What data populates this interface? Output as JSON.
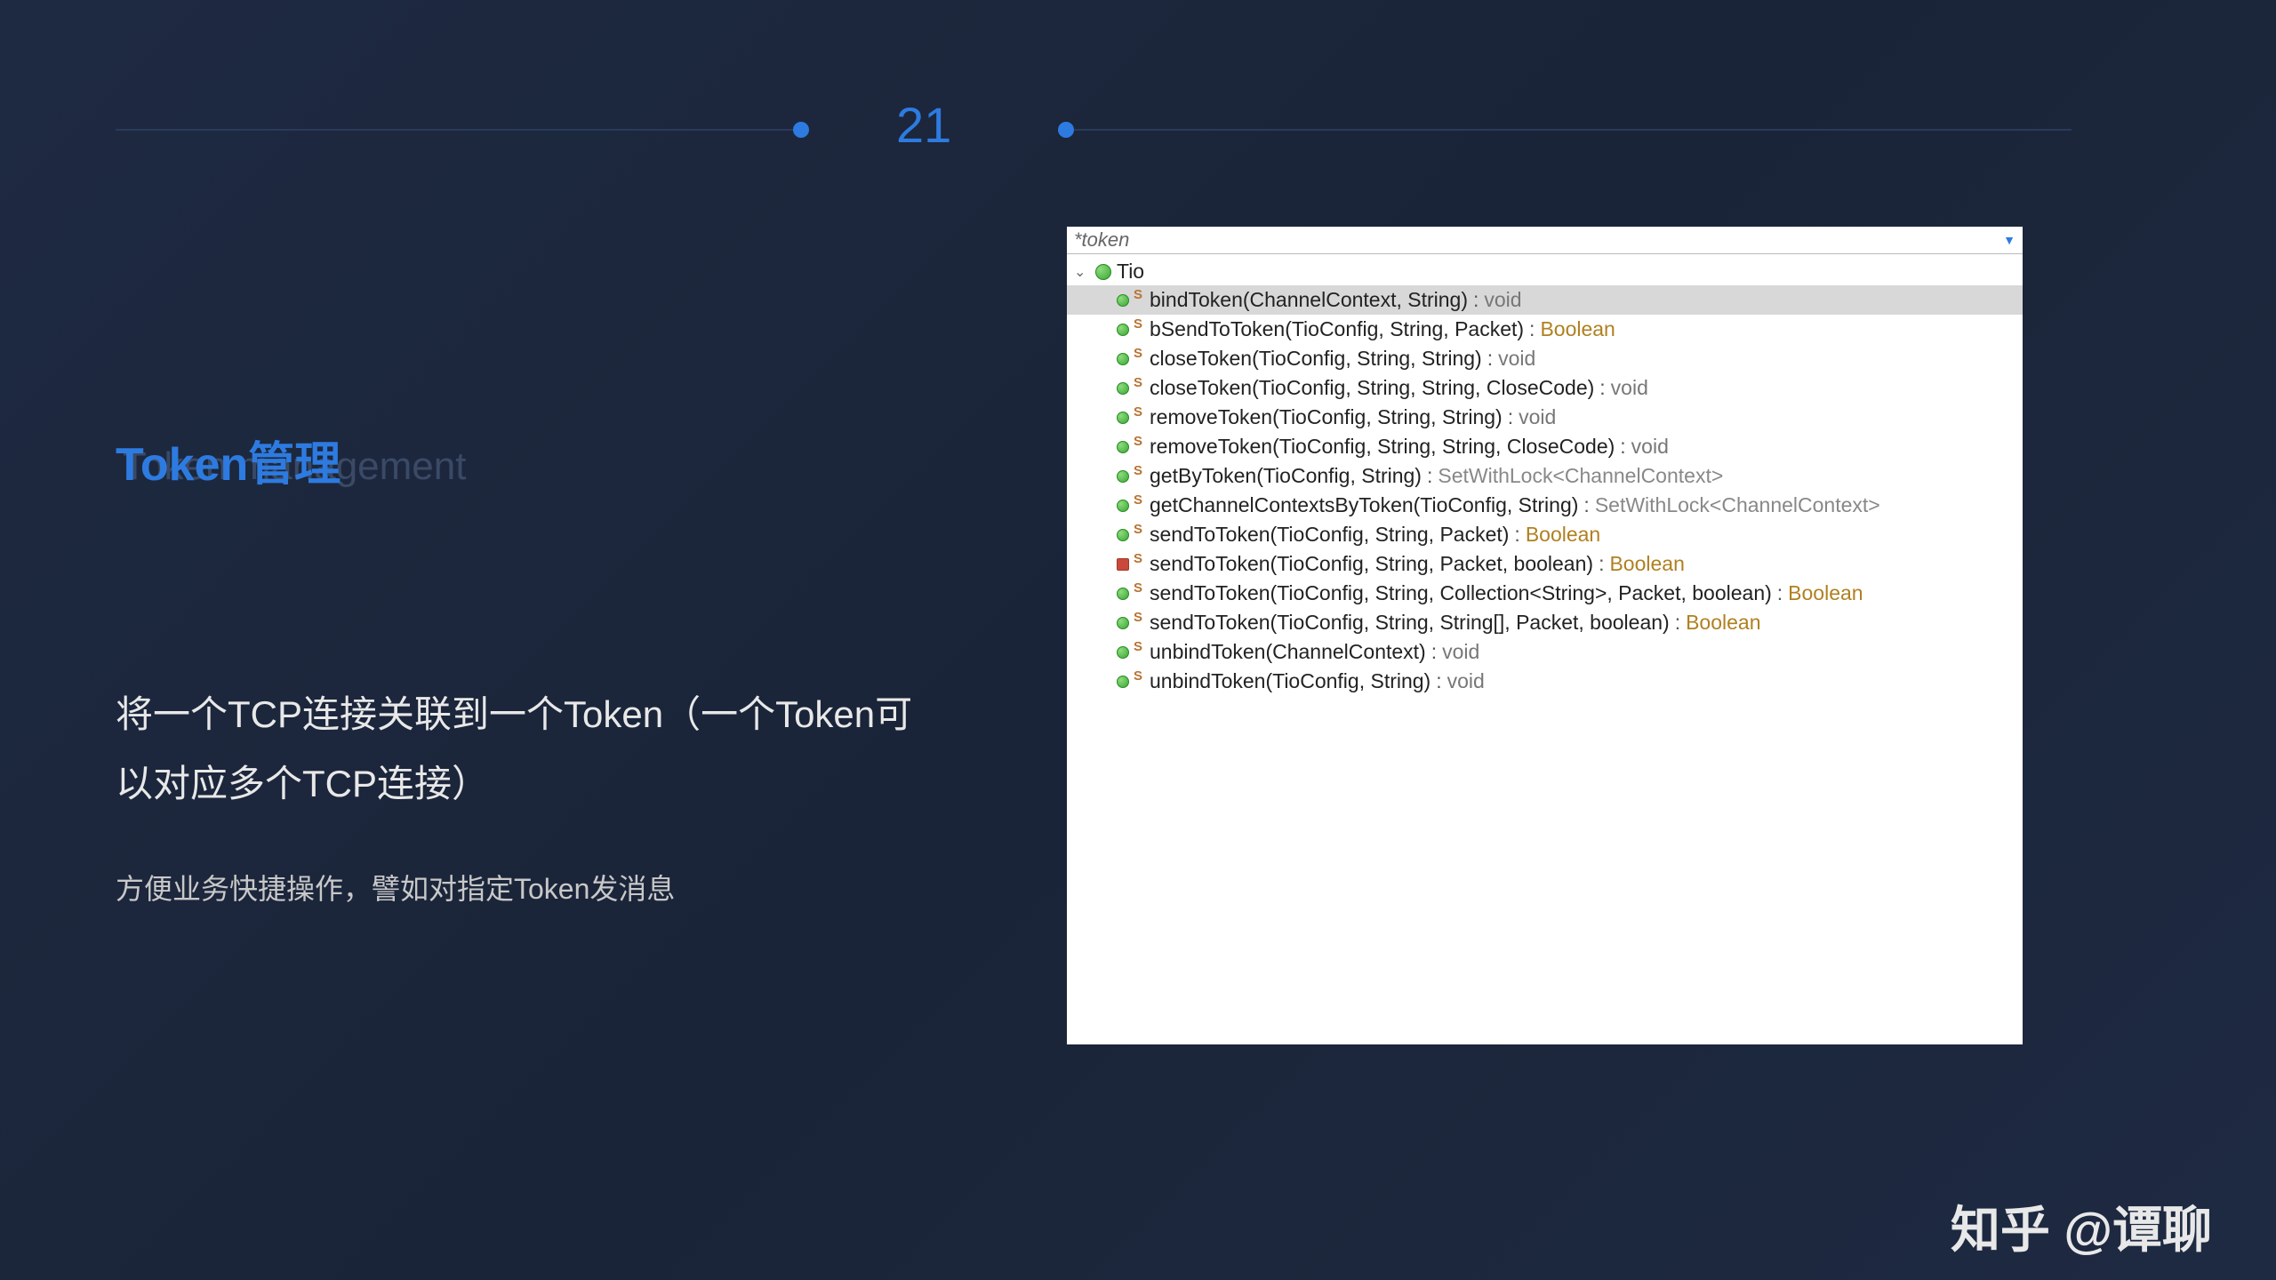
{
  "pageNumber": "21",
  "title": "Token管理",
  "subtitle": "Token management",
  "description": "将一个TCP连接关联到一个Token（一个Token可以对应多个TCP连接）",
  "subDescription": "方便业务快捷操作，譬如对指定Token发消息",
  "codePanel": {
    "searchText": "*token",
    "className": "Tio",
    "methods": [
      {
        "icon": "green",
        "name": "bindToken(ChannelContext, String)",
        "ret": "void",
        "retClass": "ret-void",
        "selected": true
      },
      {
        "icon": "green",
        "name": "bSendToToken(TioConfig, String, Packet)",
        "ret": "Boolean",
        "retClass": "ret-type",
        "selected": false
      },
      {
        "icon": "green",
        "name": "closeToken(TioConfig, String, String)",
        "ret": "void",
        "retClass": "ret-void",
        "selected": false
      },
      {
        "icon": "green",
        "name": "closeToken(TioConfig, String, String, CloseCode)",
        "ret": "void",
        "retClass": "ret-void",
        "selected": false
      },
      {
        "icon": "green",
        "name": "removeToken(TioConfig, String, String)",
        "ret": "void",
        "retClass": "ret-void",
        "selected": false
      },
      {
        "icon": "green",
        "name": "removeToken(TioConfig, String, String, CloseCode)",
        "ret": "void",
        "retClass": "ret-void",
        "selected": false
      },
      {
        "icon": "green",
        "name": "getByToken(TioConfig, String)",
        "ret": "SetWithLock<ChannelContext>",
        "retClass": "ret-generic",
        "selected": false
      },
      {
        "icon": "dep",
        "name": "getChannelContextsByToken(TioConfig, String)",
        "ret": "SetWithLock<ChannelContext>",
        "retClass": "ret-generic",
        "selected": false
      },
      {
        "icon": "green",
        "name": "sendToToken(TioConfig, String, Packet)",
        "ret": "Boolean",
        "retClass": "ret-type",
        "selected": false
      },
      {
        "icon": "red",
        "name": "sendToToken(TioConfig, String, Packet, boolean)",
        "ret": "Boolean",
        "retClass": "ret-type",
        "selected": false
      },
      {
        "icon": "green",
        "name": "sendToToken(TioConfig, String, Collection<String>, Packet, boolean)",
        "ret": "Boolean",
        "retClass": "ret-type",
        "selected": false
      },
      {
        "icon": "green",
        "name": "sendToToken(TioConfig, String, String[], Packet, boolean)",
        "ret": "Boolean",
        "retClass": "ret-type",
        "selected": false
      },
      {
        "icon": "green",
        "name": "unbindToken(ChannelContext)",
        "ret": "void",
        "retClass": "ret-void",
        "selected": false
      },
      {
        "icon": "green",
        "name": "unbindToken(TioConfig, String)",
        "ret": "void",
        "retClass": "ret-void",
        "selected": false
      }
    ]
  },
  "watermark": "知乎 @谭聊"
}
